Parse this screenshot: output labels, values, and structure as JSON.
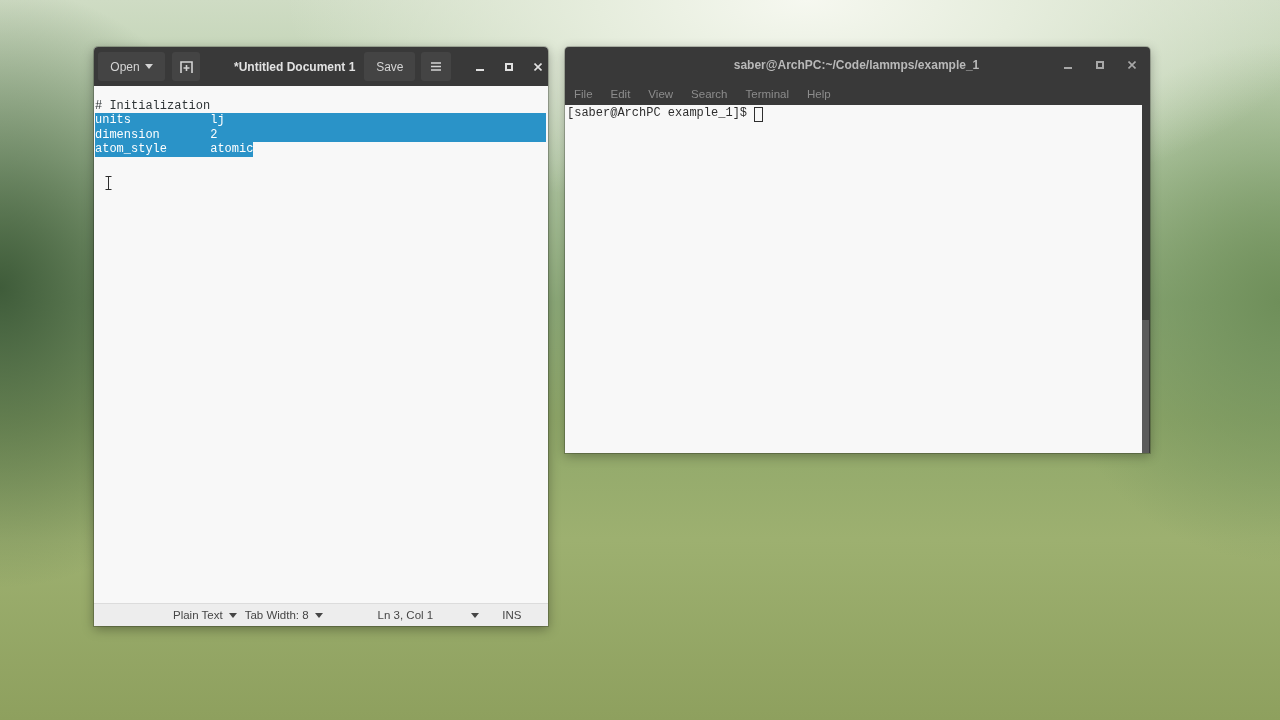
{
  "editor": {
    "open_button": "Open",
    "title": "*Untitled Document 1",
    "save_button": "Save",
    "lines": [
      {
        "text": "# Initialization",
        "selected": false,
        "newline_selected": false
      },
      {
        "text": "units\t\tlj",
        "selected": true,
        "newline_selected": true
      },
      {
        "text": "dimension\t2",
        "selected": true,
        "newline_selected": true
      },
      {
        "text": "atom_style\tatomic",
        "selected": true,
        "newline_selected": false
      }
    ],
    "status_bar": {
      "language": "Plain Text",
      "tab_width": "Tab Width: 8",
      "position": "Ln 3, Col 1",
      "mode": "INS"
    }
  },
  "terminal": {
    "title": "saber@ArchPC:~/Code/lammps/example_1",
    "menu": [
      "File",
      "Edit",
      "View",
      "Search",
      "Terminal",
      "Help"
    ],
    "prompt": "[saber@ArchPC example_1]$"
  }
}
